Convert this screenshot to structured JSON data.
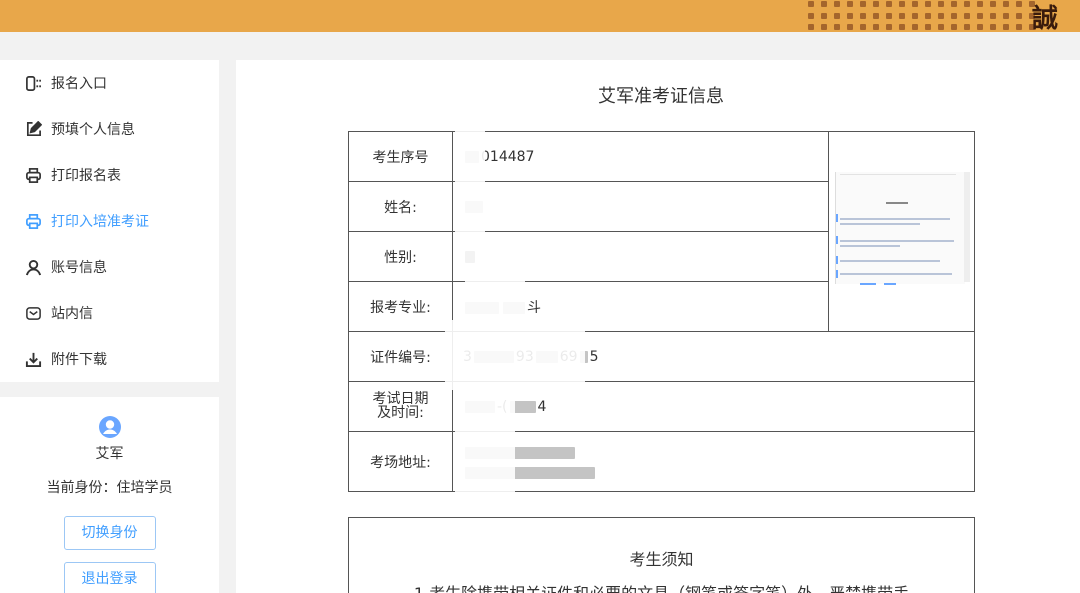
{
  "header": {
    "logo_char": "誠"
  },
  "sidebar": {
    "items": [
      {
        "label": "报名入口",
        "icon": "entry-icon"
      },
      {
        "label": "预填个人信息",
        "icon": "edit-icon"
      },
      {
        "label": "打印报名表",
        "icon": "printer-icon"
      },
      {
        "label": "打印入培准考证",
        "icon": "printer-icon",
        "active": true
      },
      {
        "label": "账号信息",
        "icon": "user-icon"
      },
      {
        "label": "站内信",
        "icon": "mail-icon"
      },
      {
        "label": "附件下载",
        "icon": "download-icon"
      }
    ]
  },
  "profile": {
    "name": "艾军",
    "role": "当前身份：住培学员",
    "switch_label": "切换身份",
    "logout_label": "退出登录"
  },
  "main": {
    "title": "艾军准考证信息",
    "fields": {
      "seq_label": "考生序号",
      "seq_value": "014487",
      "name_label": "姓名:",
      "gender_label": "性别:",
      "major_label": "报考专业:",
      "major_value": "斗",
      "id_label": "证件编号:",
      "id_value_a": "3",
      "id_value_b": "93",
      "id_value_c": "69",
      "id_value_d": "5",
      "date_label_1": "考试日期",
      "date_label_2": "及时间:",
      "date_value_a": "-(",
      "date_value_b": "4",
      "place_label": "考场地址:"
    },
    "notice": {
      "title": "考生须知",
      "text": "1.考生除携带相关证件和必要的文具（钢笔或签字笔）外，严禁携带手"
    }
  },
  "colors": {
    "header_bg": "#e8a74a",
    "accent": "#409eff"
  }
}
